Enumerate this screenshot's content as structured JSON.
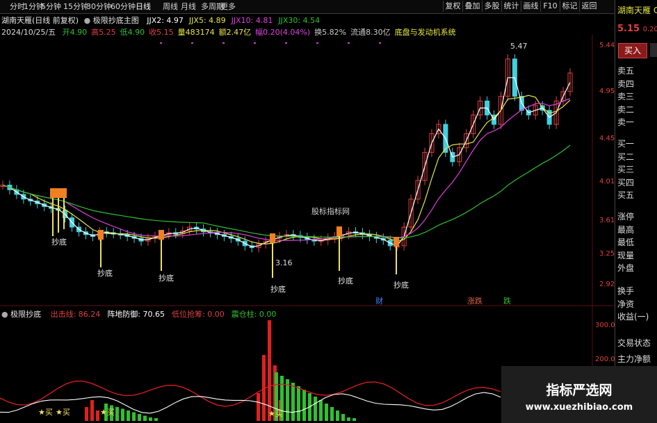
{
  "toolbar": {
    "periods": [
      "分时",
      "1分钟",
      "5分钟",
      "15分钟",
      "30分钟",
      "60分钟",
      "日线",
      "周线",
      "月线",
      "多周期",
      "更多"
    ],
    "active_period": "日线",
    "right_buttons": [
      "复权",
      "叠加",
      "多股",
      "统计",
      "画线",
      "F10",
      "标记",
      "返回"
    ]
  },
  "main": {
    "title": "湖南天雁(日线 前复权)",
    "indicator_name": "极限抄底主图",
    "ma_items": [
      {
        "label": "JJX2: 4.97",
        "color": "#ffffff"
      },
      {
        "label": "JJX5: 4.89",
        "color": "#e8e840"
      },
      {
        "label": "JJX10: 4.81",
        "color": "#e040e0"
      },
      {
        "label": "JJX30: 4.54",
        "color": "#30c030"
      }
    ],
    "date": "2024/10/25/五",
    "ohlc": [
      {
        "label": "开4.90",
        "color": "#30c030"
      },
      {
        "label": "高5.25",
        "color": "#e04040"
      },
      {
        "label": "低4.90",
        "color": "#30c030"
      },
      {
        "label": "收5.15",
        "color": "#e04040"
      },
      {
        "label": "量483174",
        "color": "#e8e840"
      },
      {
        "label": "额2.47亿",
        "color": "#e8e840"
      },
      {
        "label": "幅0.20(4.04%)",
        "color": "#e040e0"
      },
      {
        "label": "换5.82%",
        "color": "#cccccc"
      },
      {
        "label": "流通8.30亿",
        "color": "#cccccc"
      },
      {
        "label": "底盘与发动机系统",
        "color": "#e8e840"
      }
    ],
    "price_labels": [
      "5.44",
      "4.95",
      "4.45",
      "4.01",
      "3.61",
      "3.25",
      "2.92"
    ],
    "annotations": {
      "high": "5.47",
      "low": "3.16",
      "center_text": "股标指标网",
      "events": [
        "财",
        "涨跌",
        "跌"
      ],
      "chaodi": "抄底"
    }
  },
  "sub": {
    "title": "极限抄底",
    "items": [
      {
        "label": "出击线: 86.24",
        "color": "#e04040"
      },
      {
        "label": "阵地防御: 70.65",
        "color": "#ffffff"
      },
      {
        "label": "低位抢筹: 0.00",
        "color": "#e04040"
      },
      {
        "label": "震仓柱: 0.00",
        "color": "#30c030"
      }
    ],
    "axis": [
      "300.0",
      "200.0"
    ],
    "buy_label": "买"
  },
  "chart_data": {
    "type": "candlestick",
    "ylim": [
      2.92,
      5.47
    ],
    "closes": [
      3.95,
      3.9,
      3.85,
      3.8,
      3.78,
      3.75,
      3.72,
      3.7,
      3.68,
      3.6,
      3.5,
      3.45,
      3.42,
      3.4,
      3.45,
      3.44,
      3.43,
      3.42,
      3.4,
      3.38,
      3.35,
      3.38,
      3.4,
      3.42,
      3.44,
      3.43,
      3.46,
      3.5,
      3.48,
      3.45,
      3.44,
      3.42,
      3.4,
      3.38,
      3.35,
      3.3,
      3.28,
      3.32,
      3.35,
      3.38,
      3.4,
      3.42,
      3.41,
      3.39,
      3.37,
      3.35,
      3.36,
      3.38,
      3.4,
      3.42,
      3.45,
      3.44,
      3.42,
      3.4,
      3.38,
      3.36,
      3.3,
      3.3,
      3.5,
      3.8,
      4.0,
      4.3,
      4.5,
      4.6,
      4.3,
      4.2,
      4.35,
      4.5,
      4.7,
      4.85,
      4.7,
      4.6,
      4.9,
      5.3,
      4.9,
      4.75,
      4.7,
      4.8,
      4.75,
      4.6,
      4.85,
      4.95,
      5.15
    ],
    "events": [
      "财",
      "涨跌",
      "跌"
    ],
    "chaodi_signals": 7
  }
}
